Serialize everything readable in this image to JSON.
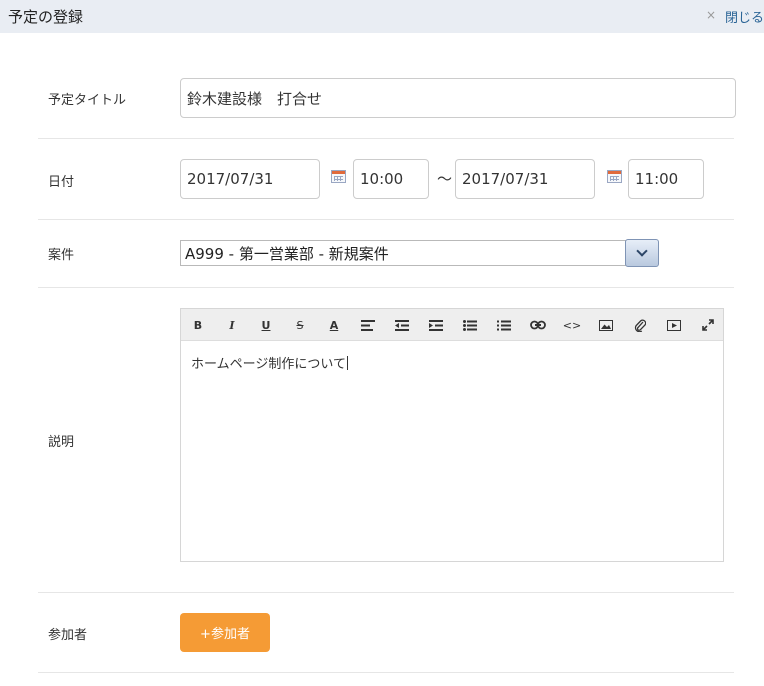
{
  "header": {
    "title": "予定の登録",
    "close_symbol": "×",
    "close_label": "閉じる"
  },
  "form": {
    "title_label": "予定タイトル",
    "title_value": "鈴木建設様　打合せ",
    "date_label": "日付",
    "start_date": "2017/07/31",
    "start_time": "10:00",
    "range_separator": "～",
    "end_date": "2017/07/31",
    "end_time": "11:00",
    "case_label": "案件",
    "case_value": "A999 - 第一営業部 - 新規案件",
    "description_label": "説明",
    "description_value": "ホームページ制作について",
    "participants_label": "参加者",
    "add_participant_label": "+参加者"
  },
  "toolbar": {
    "bold": "B",
    "italic": "I",
    "underline": "U",
    "strike": "S",
    "font_color": "A",
    "code": "<>"
  },
  "colors": {
    "header_bg": "#e9edf3",
    "link": "#2a6496",
    "accent_button": "#f59b35"
  }
}
